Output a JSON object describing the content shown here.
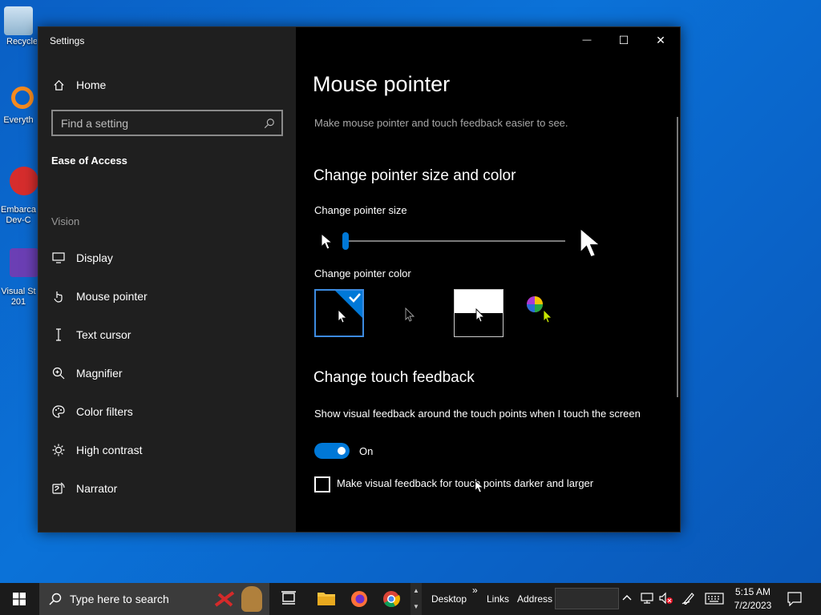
{
  "desktop": {
    "icons": [
      {
        "label": "Recycle",
        "name": "recycle-bin"
      },
      {
        "label": "Everyth",
        "name": "everything"
      },
      {
        "label": "Embarca Dev-C",
        "name": "embarcadero-dev-cpp"
      },
      {
        "label": "Visual St 201",
        "name": "visual-studio"
      }
    ]
  },
  "window": {
    "title": "Settings",
    "minimize_glyph": "—",
    "maximize_glyph": "☐",
    "close_glyph": "✕"
  },
  "sidebar": {
    "home_label": "Home",
    "search_placeholder": "Find a setting",
    "section_label": "Ease of Access",
    "group_label": "Vision",
    "items": [
      {
        "label": "Display",
        "icon": "display-icon"
      },
      {
        "label": "Mouse pointer",
        "icon": "mouse-pointer-icon"
      },
      {
        "label": "Text cursor",
        "icon": "text-cursor-icon"
      },
      {
        "label": "Magnifier",
        "icon": "magnifier-icon"
      },
      {
        "label": "Color filters",
        "icon": "color-filters-icon"
      },
      {
        "label": "High contrast",
        "icon": "high-contrast-icon"
      },
      {
        "label": "Narrator",
        "icon": "narrator-icon"
      }
    ]
  },
  "main": {
    "title": "Mouse pointer",
    "description": "Make mouse pointer and touch feedback easier to see.",
    "pointer_section": {
      "heading": "Change pointer size and color",
      "size_label": "Change pointer size",
      "size_value_fraction": 0.0,
      "color_label": "Change pointer color",
      "color_options": [
        "white",
        "black",
        "inverted",
        "custom"
      ],
      "selected_color": "white"
    },
    "touch_section": {
      "heading": "Change touch feedback",
      "feedback_label": "Show visual feedback around the touch points when I touch the screen",
      "toggle_state": "On",
      "checkbox_label": "Make visual feedback for touch points darker and larger",
      "checkbox_checked": false
    }
  },
  "taskbar": {
    "search_placeholder": "Type here to search",
    "desktop_label": "Desktop",
    "overflow_glyph": "»",
    "links_label": "Links",
    "address_label": "Address",
    "time": "5:15 AM",
    "date": "7/2/2023"
  },
  "colors": {
    "accent": "#0078d7",
    "desktop_bg": "#0b6ad2",
    "sidebar_bg": "#1f1f1f",
    "content_bg": "#000000"
  }
}
